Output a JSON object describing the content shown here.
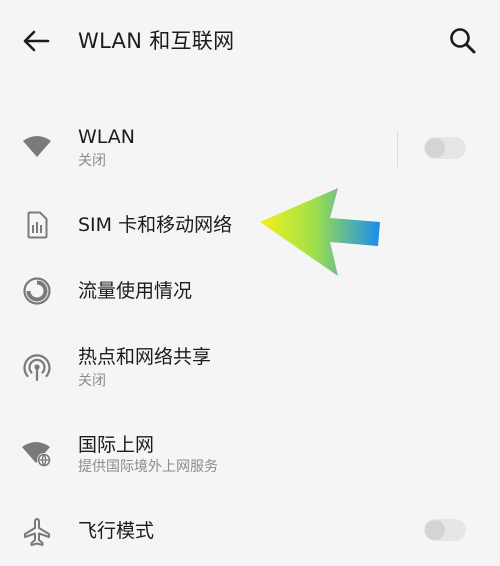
{
  "header": {
    "title": "WLAN 和互联网",
    "back_icon": "arrow-left-icon",
    "search_icon": "search-icon"
  },
  "items": [
    {
      "label": "WLAN",
      "sub": "关闭",
      "icon": "wifi-icon",
      "toggle": false
    },
    {
      "label": "SIM 卡和移动网络",
      "icon": "sim-card-icon"
    },
    {
      "label": "流量使用情况",
      "icon": "data-usage-icon"
    },
    {
      "label": "热点和网络共享",
      "sub": "关闭",
      "icon": "hotspot-icon"
    },
    {
      "label": "国际上网",
      "sub": "提供国际境外上网服务",
      "icon": "global-wifi-icon"
    },
    {
      "label": "飞行模式",
      "icon": "airplane-icon",
      "toggle": false
    }
  ],
  "colors": {
    "background": "#f5f5f5",
    "text_primary": "#1c1c1c",
    "text_secondary": "#8c8c8c",
    "icon": "#7a7a7a",
    "toggle_off_track": "#e6e6e6",
    "toggle_off_knob": "#d4d4d4",
    "arrow_gradient": [
      "#f2f21a",
      "#7fe07a",
      "#1a8cf0"
    ]
  }
}
